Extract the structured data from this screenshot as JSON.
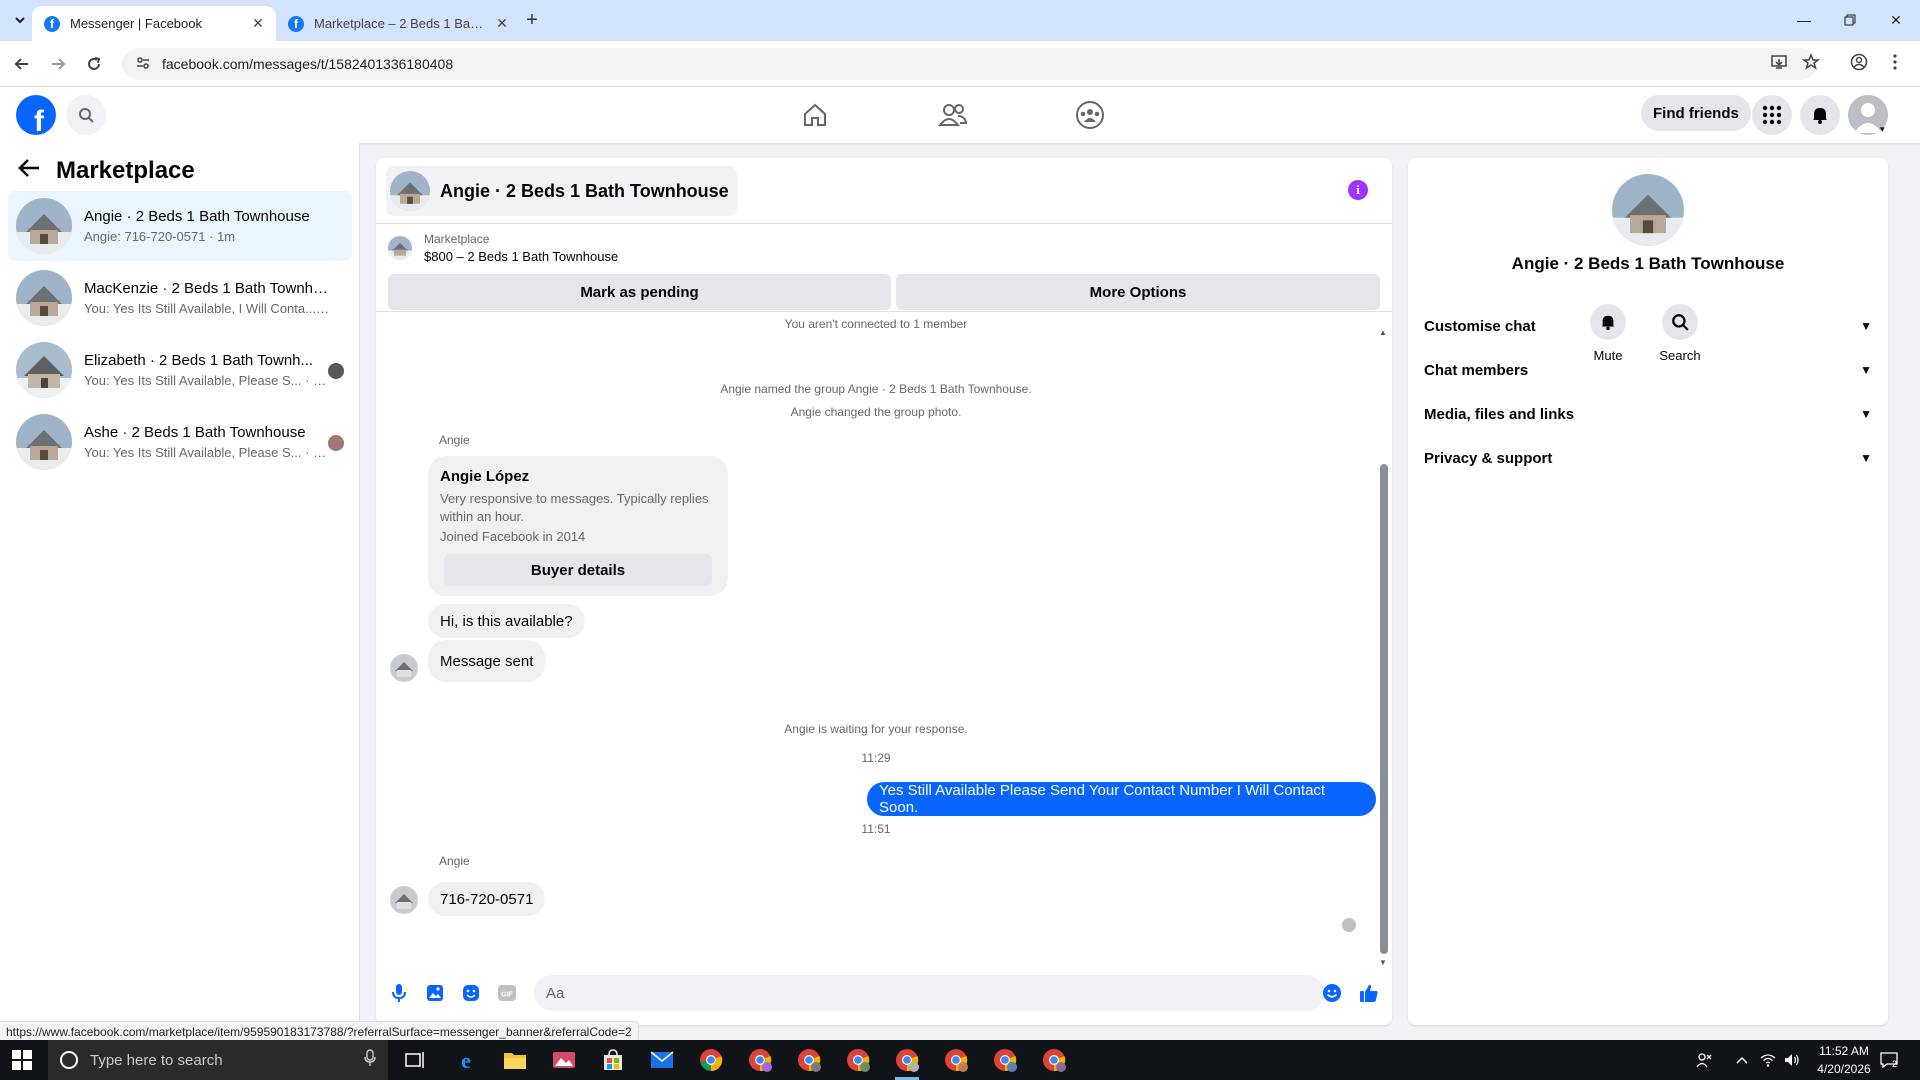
{
  "browser": {
    "tabs": [
      {
        "title": "Messenger | Facebook",
        "active": true
      },
      {
        "title": "Marketplace – 2 Beds 1 Bath To",
        "active": false
      }
    ],
    "url": "facebook.com/messages/t/1582401336180408",
    "status_url": "https://www.facebook.com/marketplace/item/959590183173788/?referralSurface=messenger_banner&referralCode=2"
  },
  "fb_header": {
    "find_friends_label": "Find friends"
  },
  "left_panel": {
    "title": "Marketplace",
    "conversations": [
      {
        "name": "Angie · 2 Beds 1 Bath Townhouse",
        "preview": "Angie: 716-720-0571 · 1m",
        "active": true
      },
      {
        "name": "MacKenzie · 2 Beds 1 Bath Townho...",
        "preview": "You: Yes Its Still Available, I Will Conta... · 1w",
        "active": false
      },
      {
        "name": "Elizabeth · 2 Beds 1 Bath Townh...",
        "preview": "You: Yes Its Still Available, Please S... · 3w",
        "active": false
      },
      {
        "name": "Ashe · 2 Beds 1 Bath Townhouse",
        "preview": "You: Yes Its Still Available, Please S... · 6w",
        "active": false
      }
    ]
  },
  "chat": {
    "title": "Angie · 2 Beds 1 Bath Townhouse",
    "listing": {
      "source": "Marketplace",
      "title": "$800 – 2 Beds 1 Bath Townhouse",
      "mark_pending_label": "Mark as pending",
      "more_options_label": "More Options"
    },
    "system_messages": {
      "not_connected": "You aren't connected to 1 member",
      "named_group": "Angie named the group Angie · 2 Beds 1 Bath Townhouse.",
      "changed_photo": "Angie changed the group photo.",
      "waiting": "Angie is waiting for your response."
    },
    "sender_name": "Angie",
    "buyer_card": {
      "name": "Angie López",
      "line1": "Very responsive to messages. Typically replies within an hour.",
      "line2": "Joined Facebook in 2014",
      "button_label": "Buyer details"
    },
    "messages": {
      "incoming_1": "Hi, is this available?",
      "incoming_2": "Message sent",
      "time_1": "11:29",
      "outgoing_1": "Yes Still Available Please Send Your Contact Number I Will Contact Soon.",
      "time_2": "11:51",
      "incoming_3": "716-720-0571"
    },
    "composer_placeholder": "Aa"
  },
  "info_panel": {
    "name": "Angie · 2 Beds 1 Bath Townhouse",
    "actions": {
      "mute": "Mute",
      "search": "Search"
    },
    "sections": [
      "Customise chat",
      "Chat members",
      "Media, files and links",
      "Privacy & support"
    ]
  },
  "taskbar": {
    "search_placeholder": "Type here to search",
    "time": "11:52 AM",
    "date": "4/20/2026",
    "notifications": "2"
  },
  "colors": {
    "fb_blue": "#0866ff",
    "info_purple": "#a033ff",
    "active_conv_bg": "#ebf5ff"
  }
}
